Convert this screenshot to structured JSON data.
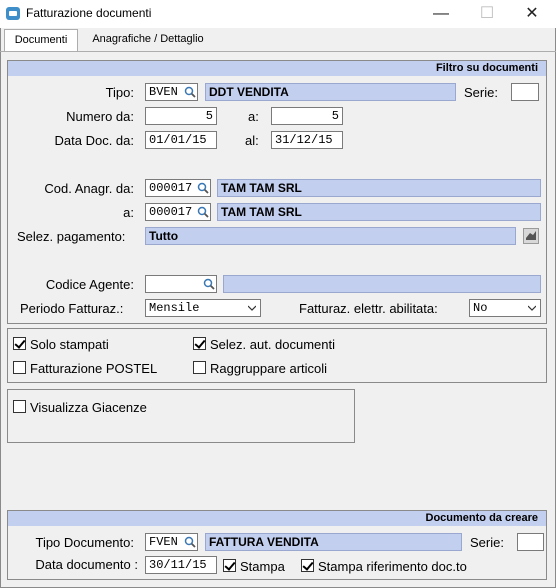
{
  "window": {
    "title": "Fatturazione documenti",
    "minimize": "—",
    "maximize": "☐",
    "close": "✕"
  },
  "tabs": [
    {
      "label": "Documenti"
    },
    {
      "label": "Anagrafiche / Dettaglio"
    }
  ],
  "filter": {
    "header": "Filtro su documenti",
    "tipo_label": "Tipo:",
    "tipo_value": "BVEN",
    "tipo_desc": "DDT VENDITA",
    "serie_label": "Serie:",
    "serie_value": "",
    "numero_da_label": "Numero da:",
    "numero_da_value": "5",
    "numero_a_label": "a:",
    "numero_a_value": "5",
    "data_da_label": "Data Doc. da:",
    "data_da_value": "01/01/15",
    "data_al_label": "al:",
    "data_al_value": "31/12/15",
    "anagr_da_label": "Cod. Anagr. da:",
    "anagr_da_value": "000017",
    "anagr_da_desc": "TAM TAM SRL",
    "anagr_a_label": "a:",
    "anagr_a_value": "000017",
    "anagr_a_desc": "TAM TAM SRL",
    "pagamento_label": "Selez. pagamento:",
    "pagamento_value": "Tutto",
    "agente_label": "Codice Agente:",
    "agente_value": "",
    "agente_desc": "",
    "periodo_label": "Periodo Fatturaz.:",
    "periodo_value": "Mensile",
    "elettr_label": "Fatturaz. elettr. abilitata:",
    "elettr_value": "No"
  },
  "options": {
    "solo_stampati": {
      "label": "Solo stampati",
      "checked": true
    },
    "selez_aut": {
      "label": "Selez. aut. documenti",
      "checked": true
    },
    "postel": {
      "label": "Fatturazione POSTEL",
      "checked": false
    },
    "raggruppare": {
      "label": "Raggruppare articoli",
      "checked": false
    },
    "giacenze": {
      "label": "Visualizza Giacenze",
      "checked": false
    }
  },
  "create": {
    "header": "Documento da creare",
    "tipo_label": "Tipo Documento:",
    "tipo_value": "FVEN",
    "tipo_desc": "FATTURA VENDITA",
    "serie_label": "Serie:",
    "serie_value": "",
    "data_label": "Data documento :",
    "data_value": "30/11/15",
    "stampa": {
      "label": "Stampa",
      "checked": true
    },
    "stampa_rif": {
      "label": "Stampa riferimento doc.to",
      "checked": true
    }
  }
}
